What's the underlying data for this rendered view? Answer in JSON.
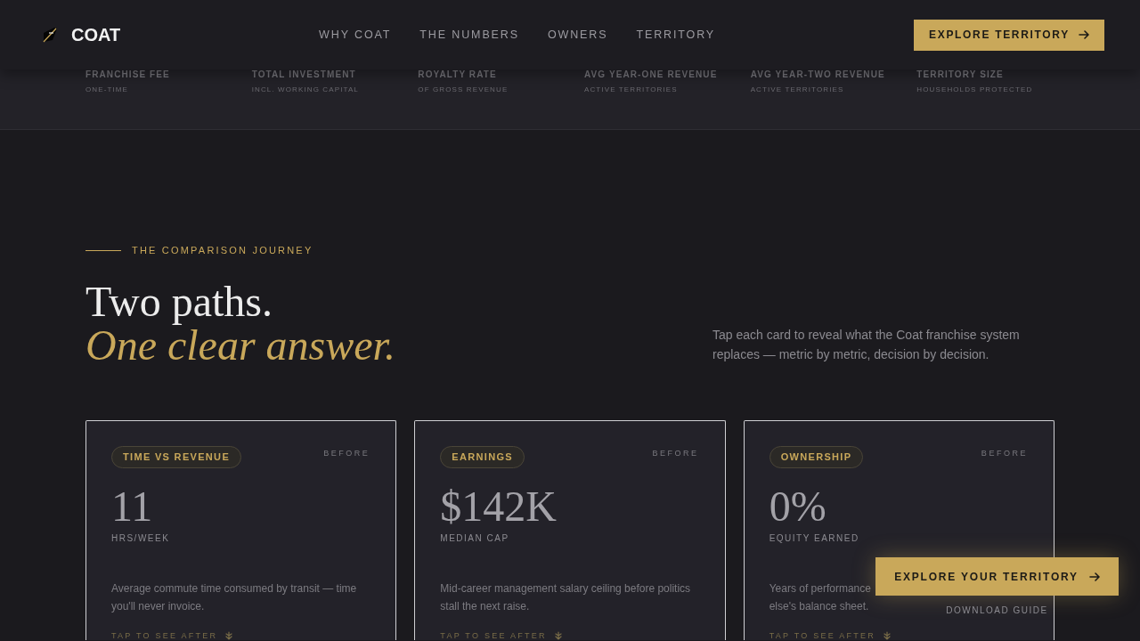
{
  "header": {
    "logo": "COAT",
    "nav": [
      {
        "label": "WHY COAT"
      },
      {
        "label": "THE NUMBERS"
      },
      {
        "label": "OWNERS"
      },
      {
        "label": "TERRITORY"
      }
    ],
    "cta": "EXPLORE TERRITORY"
  },
  "stats": [
    {
      "label": "FRANCHISE FEE",
      "sublabel": "ONE-TIME"
    },
    {
      "label": "TOTAL INVESTMENT",
      "sublabel": "INCL. WORKING CAPITAL"
    },
    {
      "label": "ROYALTY RATE",
      "sublabel": "OF GROSS REVENUE"
    },
    {
      "label": "AVG YEAR-ONE REVENUE",
      "sublabel": "ACTIVE TERRITORIES"
    },
    {
      "label": "AVG YEAR-TWO REVENUE",
      "sublabel": "ACTIVE TERRITORIES"
    },
    {
      "label": "TERRITORY SIZE",
      "sublabel": "HOUSEHOLDS PROTECTED"
    }
  ],
  "section": {
    "eyebrow": "THE COMPARISON JOURNEY",
    "title": "Two paths.",
    "title_accent": "One clear answer.",
    "intro": "Tap each card to reveal what the Coat franchise system replaces — metric by metric, decision by decision."
  },
  "cards": [
    {
      "tag": "TIME VS REVENUE",
      "phase": "BEFORE",
      "value": "11",
      "unit": "HRS/WEEK",
      "description_lines": [
        "Average commute time consumed by transit — time you'll never invoice."
      ],
      "hint": "TAP TO SEE AFTER"
    },
    {
      "tag": "EARNINGS",
      "phase": "BEFORE",
      "value": "$142K",
      "unit": "MEDIAN CAP",
      "description_lines": [
        "Mid-career management salary ceiling before politics stall the next raise."
      ],
      "hint": "TAP TO SEE AFTER"
    },
    {
      "tag": "OWNERSHIP",
      "phase": "BEFORE",
      "value": "0%",
      "unit": "EQUITY EARNED",
      "description_lines": [
        "Years of performance",
        "else's balance sheet."
      ],
      "hint": "TAP TO SEE AFTER"
    }
  ],
  "floating_cta": {
    "button": "EXPLORE YOUR TERRITORY",
    "link": "DOWNLOAD GUIDE"
  }
}
